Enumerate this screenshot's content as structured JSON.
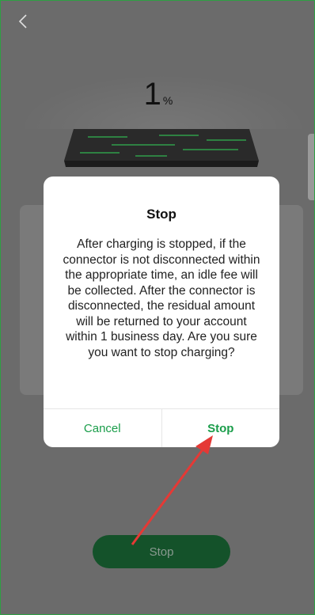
{
  "header": {
    "back_icon": "chevron-left-icon"
  },
  "charging": {
    "percent_value": "1",
    "percent_unit": "%"
  },
  "dialog": {
    "title": "Stop",
    "message": "After charging is stopped, if the connector is not disconnected within the appropriate time, an idle fee will be collected. After the connector is disconnected, the residual amount will be returned to your account within 1 business day. Are you sure you want to stop charging?",
    "cancel_label": "Cancel",
    "stop_label": "Stop"
  },
  "main_actions": {
    "stop_label": "Stop"
  },
  "colors": {
    "accent": "#1a9d4a",
    "overlay": "#6b6b6b",
    "arrow": "#e53935"
  }
}
